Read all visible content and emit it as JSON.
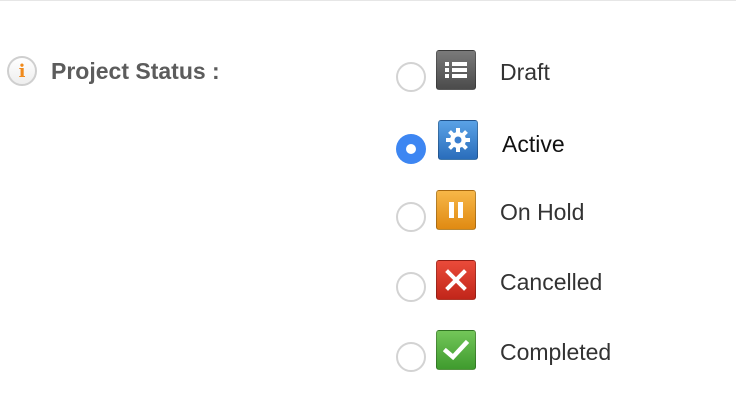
{
  "field": {
    "label": "Project Status :",
    "info_icon_glyph": "i"
  },
  "statuses": [
    {
      "label": "Draft",
      "icon": "list-icon",
      "color": "#5e5e5e",
      "selected": false
    },
    {
      "label": "Active",
      "icon": "gear-icon",
      "color": "#3a7fd0",
      "selected": true
    },
    {
      "label": "On Hold",
      "icon": "pause-icon",
      "color": "#eda02b",
      "selected": false
    },
    {
      "label": "Cancelled",
      "icon": "close-icon",
      "color": "#d6352a",
      "selected": false
    },
    {
      "label": "Completed",
      "icon": "checkmark-icon",
      "color": "#5ab143",
      "selected": false
    }
  ],
  "colors": {
    "radio_selected": "#3d86f2",
    "label_text": "#5c5c5c",
    "info_accent": "#f08a1c"
  }
}
